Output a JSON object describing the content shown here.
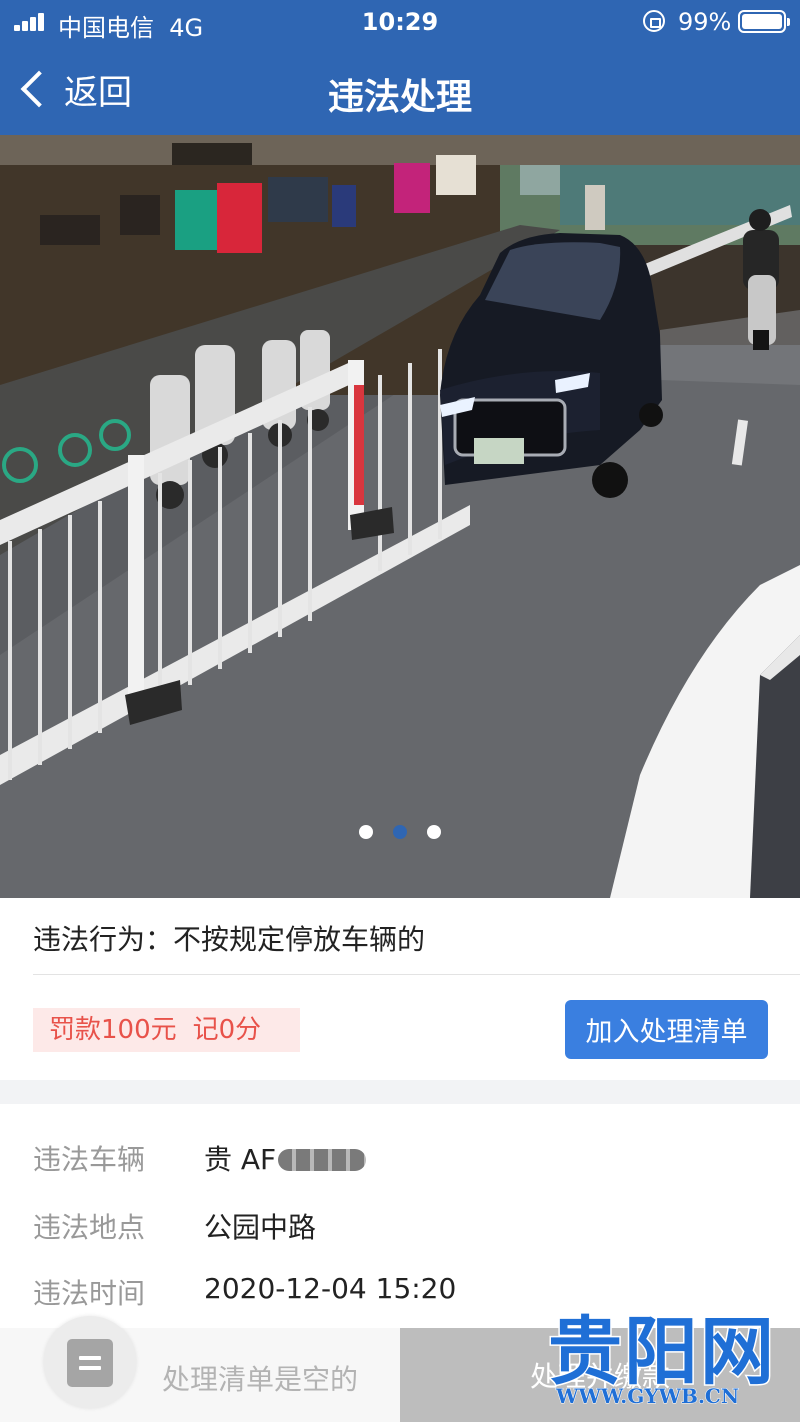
{
  "status_bar": {
    "carrier": "中国电信",
    "network": "4G",
    "time": "10:29",
    "battery": "99%"
  },
  "nav": {
    "back_label": "返回",
    "title": "违法处理"
  },
  "photo": {
    "slide_count": 3,
    "active_slide": 2
  },
  "violation": {
    "behavior_label": "违法行为：",
    "behavior_value": "不按规定停放车辆的",
    "fine": "罚款100元",
    "points": "记0分",
    "add_button": "加入处理清单"
  },
  "details": [
    {
      "key": "违法车辆",
      "value": "贵 AF"
    },
    {
      "key": "违法地点",
      "value": "公园中路"
    },
    {
      "key": "违法时间",
      "value": "2020-12-04 15:20"
    }
  ],
  "bottom_bar": {
    "empty_text": "处理清单是空的",
    "action_label": "处理并缴款"
  },
  "watermark": {
    "name": "贵阳网",
    "url": "WWW.GYWB.CN"
  },
  "colors": {
    "brand_blue": "#2f66b3",
    "button_blue": "#3a7fe0",
    "penalty_red": "#e8524a"
  }
}
